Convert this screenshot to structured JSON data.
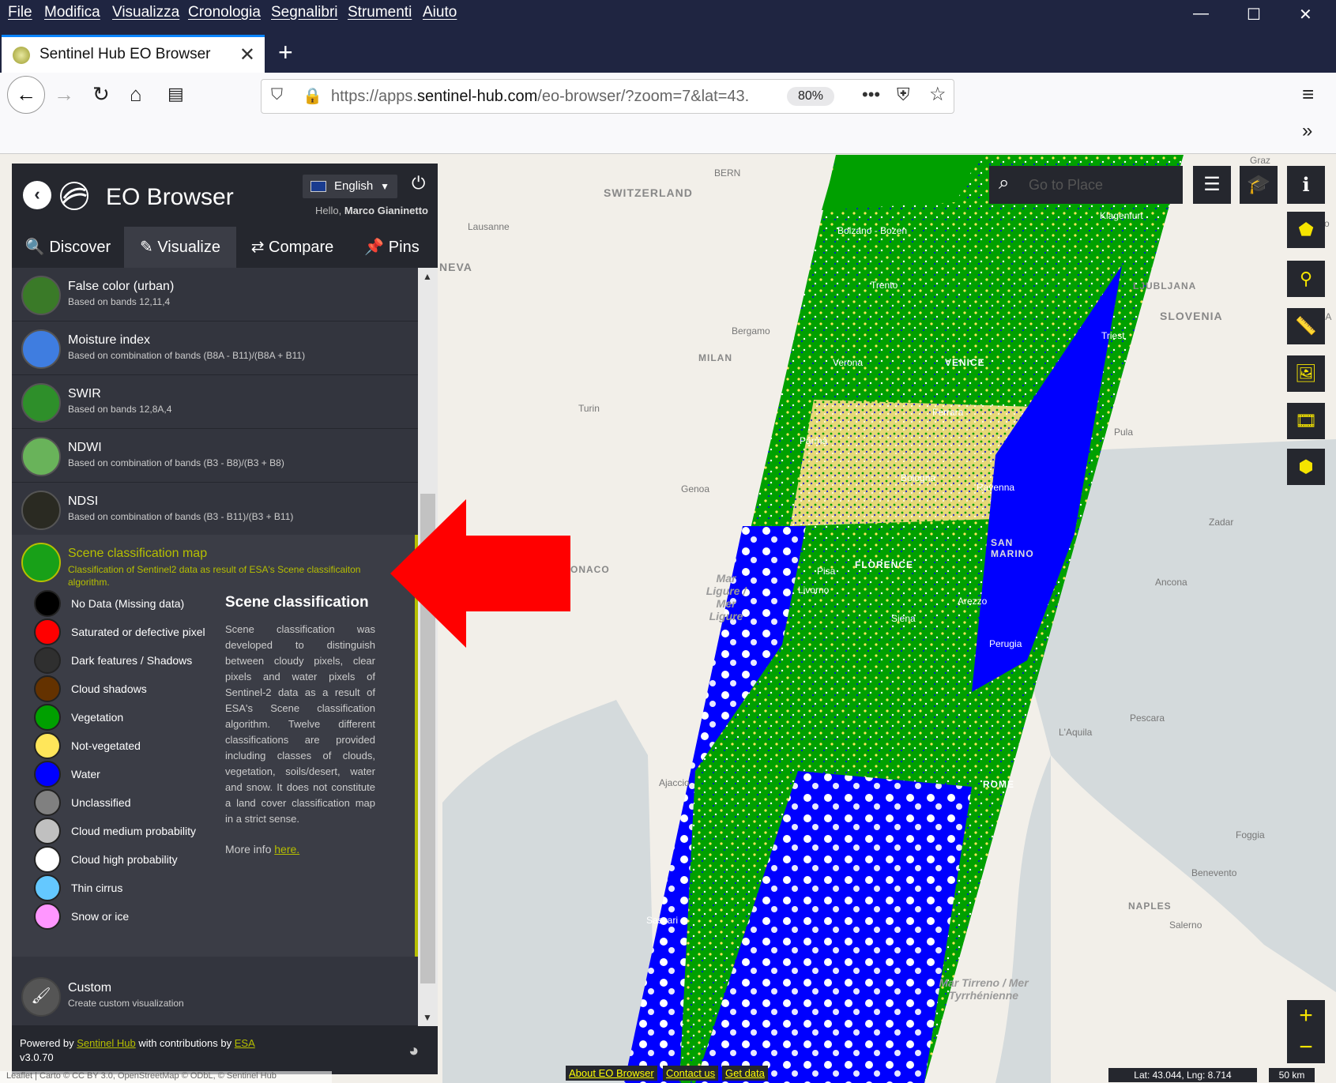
{
  "menu": [
    "File",
    "Modifica",
    "Visualizza",
    "Cronologia",
    "Segnalibri",
    "Strumenti",
    "Aiuto"
  ],
  "tab": {
    "title": "Sentinel Hub EO Browser",
    "close": "✕",
    "new": "+"
  },
  "url": {
    "prefix": "https://apps.",
    "domain": "sentinel-hub.com",
    "path": "/eo-browser/?zoom=7&lat=43.",
    "zoom": "80%"
  },
  "app": {
    "title": "EO Browser",
    "language": "English",
    "greeting": "Hello, ",
    "user": "Marco Gianinetto",
    "tabs": [
      "Discover",
      "Visualize",
      "Compare",
      "Pins"
    ]
  },
  "layers": [
    {
      "title": "False color (urban)",
      "desc": "Based on bands 12,11,4",
      "thumb": "#3a7a28"
    },
    {
      "title": "Moisture index",
      "desc": "Based on combination of bands (B8A - B11)/(B8A + B11)",
      "thumb": "#3f7de0"
    },
    {
      "title": "SWIR",
      "desc": "Based on bands 12,8A,4",
      "thumb": "#2e8f2a"
    },
    {
      "title": "NDWI",
      "desc": "Based on combination of bands (B3 - B8)/(B3 + B8)",
      "thumb": "#69b35a"
    },
    {
      "title": "NDSI",
      "desc": "Based on combination of bands (B3 - B11)/(B3 + B11)",
      "thumb": "#2a2a22"
    }
  ],
  "selected": {
    "title": "Scene classification map",
    "desc": "Classification of Sentinel2 data as result of ESA's Scene classificaiton algorithm.",
    "heading": "Scene classification",
    "text": "Scene classification was developed to distinguish between cloudy pixels, clear pixels and water pixels of Sentinel-2 data as a result of ESA's Scene classification algorithm. Twelve different classifications are provided including classes of clouds, vegetation, soils/desert, water and snow. It does not constitute a land cover classification map in a strict sense.",
    "more": "More info ",
    "more_link": "here."
  },
  "legend": [
    {
      "label": "No Data (Missing data)",
      "color": "#000000"
    },
    {
      "label": "Saturated or defective pixel",
      "color": "#ff0000"
    },
    {
      "label": "Dark features / Shadows",
      "color": "#2f2f2f"
    },
    {
      "label": "Cloud shadows",
      "color": "#643200"
    },
    {
      "label": "Vegetation",
      "color": "#00a000"
    },
    {
      "label": "Not-vegetated",
      "color": "#ffe65a"
    },
    {
      "label": "Water",
      "color": "#0000ff"
    },
    {
      "label": "Unclassified",
      "color": "#808080"
    },
    {
      "label": "Cloud medium probability",
      "color": "#c0c0c0"
    },
    {
      "label": "Cloud high probability",
      "color": "#ffffff"
    },
    {
      "label": "Thin cirrus",
      "color": "#64c8ff"
    },
    {
      "label": "Snow or ice",
      "color": "#ff96ff"
    }
  ],
  "custom": {
    "title": "Custom",
    "desc": "Create custom visualization"
  },
  "footer": {
    "powered": "Powered by ",
    "sh": "Sentinel Hub",
    "contrib": " with contributions by ",
    "esa": "ESA",
    "version": "v3.0.70"
  },
  "map": {
    "search_placeholder": "Go to Place",
    "labels": [
      "BERN",
      "SWITZERLAND",
      "Lausanne",
      "NEVA",
      "Bolzano - Bozen",
      "Klagenfurt",
      "Trento",
      "LJUBLJANA",
      "SLOVENIA",
      "Bergamo",
      "MILAN",
      "Verona",
      "VENICE",
      "Triest",
      "Turin",
      "Parma",
      "Ferrara",
      "Pula",
      "Bologna",
      "Ravenna",
      "Genoa",
      "SAN MARINO",
      "Zadar",
      "FLORENCE",
      "Pisa",
      "Livorno",
      "ONACO",
      "Ancona",
      "Arezzo",
      "Siena",
      "Perugia",
      "Pescara",
      "L'Aquila",
      "Ajaccio",
      "ROME",
      "Foggia",
      "Benevento",
      "NAPLES",
      "Salerno",
      "Sassari",
      "Maribo",
      "Graz",
      "ZA"
    ],
    "seas": [
      "Mar Ligure / Mer Ligure",
      "Mar Tirreno / Mer Tyrrhénienne"
    ],
    "coords": "Lat: 43.044, Lng: 8.714",
    "scale": "50 km",
    "links": [
      "About EO Browser",
      "Contact us",
      "Get data"
    ],
    "attribution": "Leaflet | Carto © CC BY 3.0, OpenStreetMap © ODbL, © Sentinel Hub"
  }
}
